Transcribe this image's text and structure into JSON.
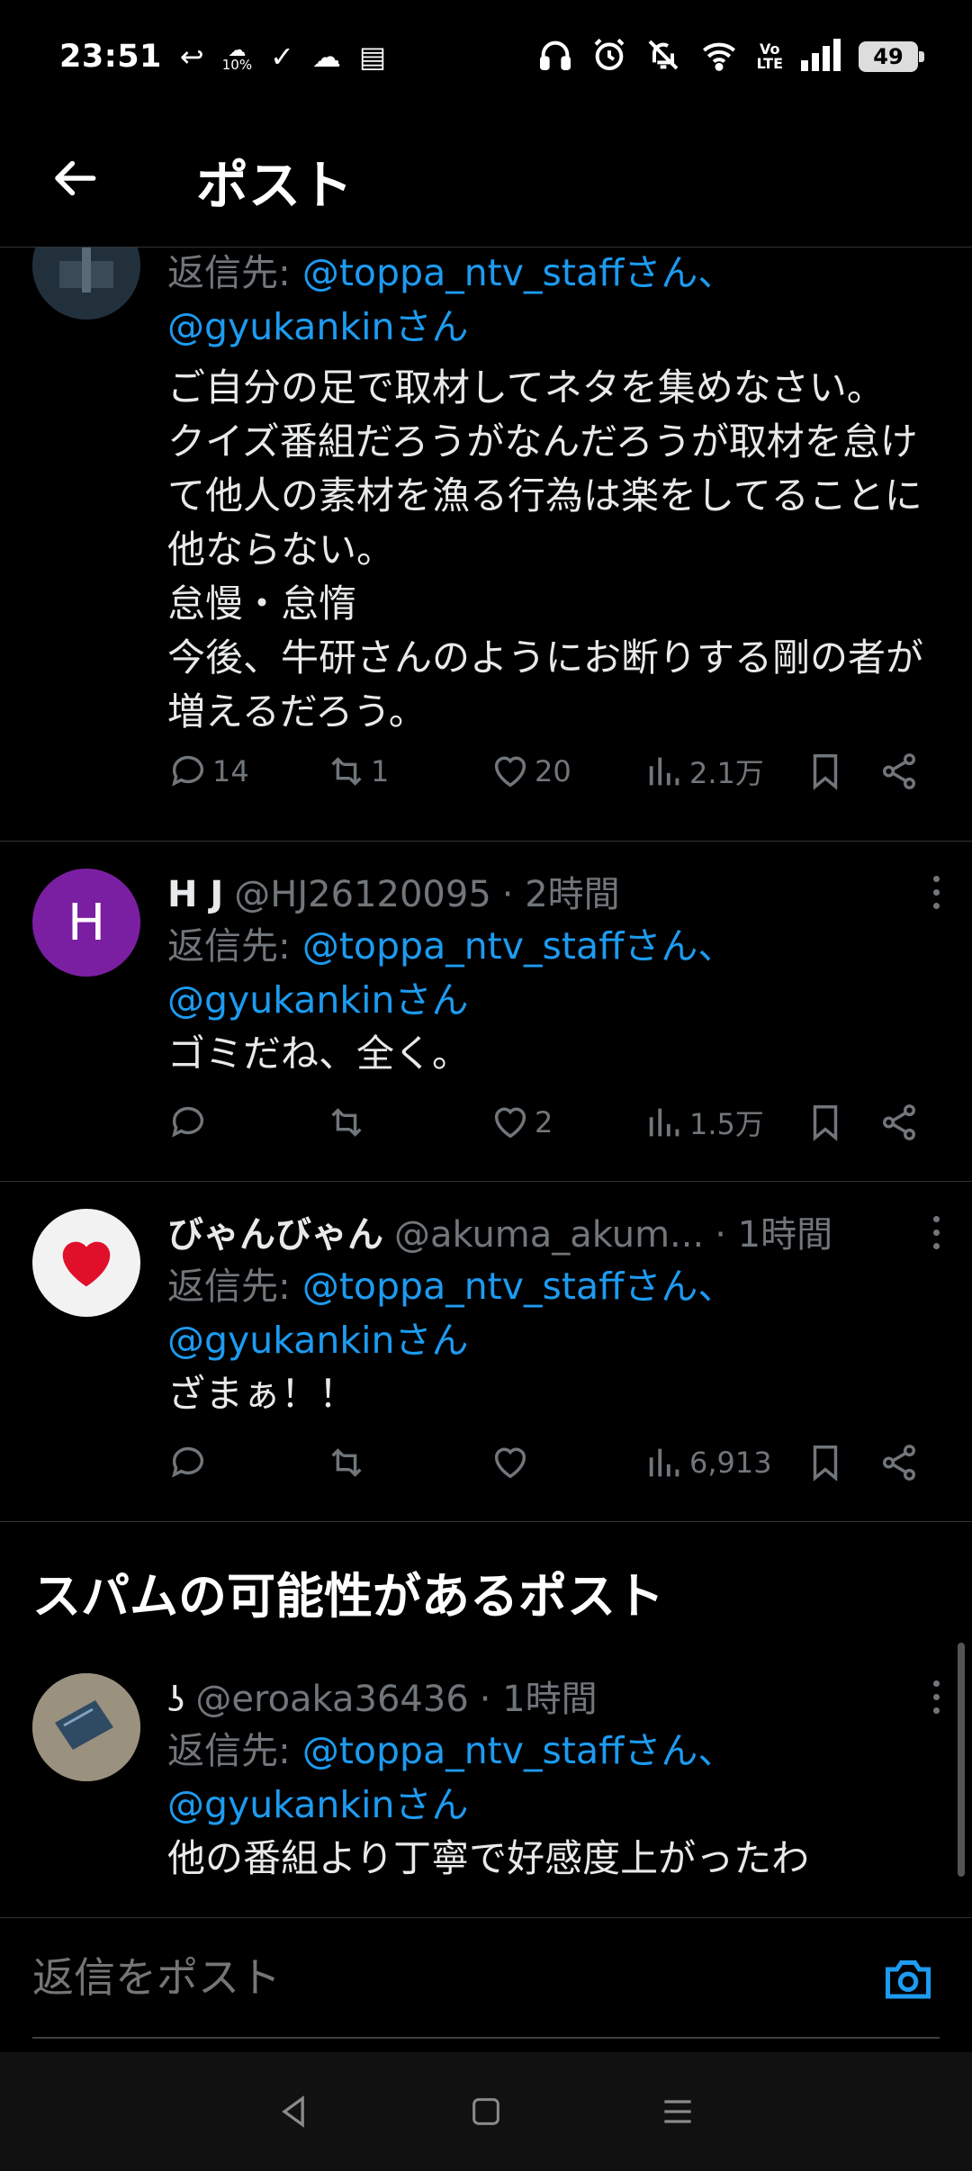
{
  "status_bar": {
    "time": "23:51",
    "battery": "49",
    "small_label": "10%",
    "icons": [
      "reply-arrow-icon",
      "weather-icon",
      "check-icon",
      "cloud-icon",
      "calendar-icon",
      "headphones-icon",
      "alarm-icon",
      "mute-icon",
      "wifi-icon",
      "volte-icon",
      "signal-icon",
      "battery-icon"
    ]
  },
  "header": {
    "title": "ポスト"
  },
  "tweets": [
    {
      "reply_prefix": "返信先: ",
      "mention1": "@toppa_ntv_staffさん、",
      "mention2": "@gyukankinさん",
      "body": "ご自分の足で取材してネタを集めなさい。\nクイズ番組だろうがなんだろうが取材を怠けて他人の素材を漁る行為は楽をしてることに他ならない。\n怠慢・怠惰\n今後、牛研さんのようにお断りする剛の者が増えるだろう。",
      "replies": "14",
      "retweets": "1",
      "likes": "20",
      "views": "2.1万"
    },
    {
      "avatar_letter": "H",
      "name": "H J",
      "handle": "@HJ26120095",
      "time": "· 2時間",
      "reply_prefix": "返信先: ",
      "mention1": "@toppa_ntv_staffさん、",
      "mention2": "@gyukankinさん",
      "body": "ゴミだね、全く。",
      "replies": "",
      "retweets": "",
      "likes": "2",
      "views": "1.5万"
    },
    {
      "name": "びゃんびゃん",
      "handle": "@akuma_akum...",
      "time": "· 1時間",
      "reply_prefix": "返信先: ",
      "mention1": "@toppa_ntv_staffさん、",
      "mention2": "@gyukankinさん",
      "body": "ざまぁ！！",
      "replies": "",
      "retweets": "",
      "likes": "",
      "views": "6,913"
    },
    {
      "handle": "@eroaka36436",
      "time": "· 1時間",
      "reply_prefix": "返信先: ",
      "mention1": "@toppa_ntv_staffさん、",
      "mention2": "@gyukankinさん",
      "body": "他の番組より丁寧で好感度上がったわ"
    }
  ],
  "spam_section": {
    "title": "スパムの可能性があるポスト"
  },
  "composer": {
    "placeholder": "返信をポスト"
  },
  "colors": {
    "accent": "#1d9bf0",
    "muted": "#71767b",
    "divider": "#2f3336",
    "avatar_purple": "#7b1fa2"
  }
}
